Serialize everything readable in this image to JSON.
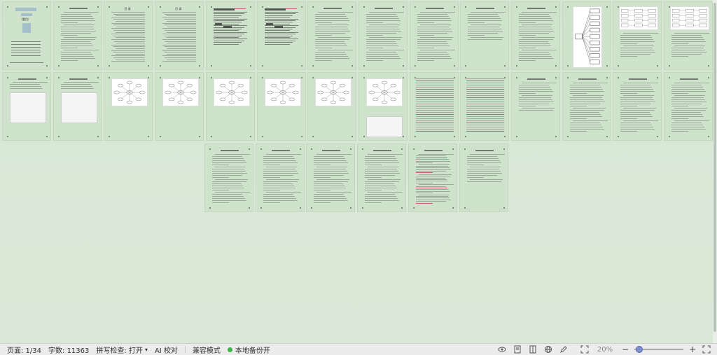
{
  "status_bar": {
    "page_label": "页面: 1/34",
    "word_count_label": "字数: 11363",
    "spell_check_label": "拼写检查: 打开",
    "spell_dropdown": "▾",
    "ai_proofread_label": "AI 校对",
    "compat_mode_label": "兼容模式",
    "backup_label": "本地备份开",
    "zoom_label": "20%"
  },
  "document": {
    "total_pages": 34,
    "cover_title": "（题目）",
    "toc_title": "目 录"
  }
}
